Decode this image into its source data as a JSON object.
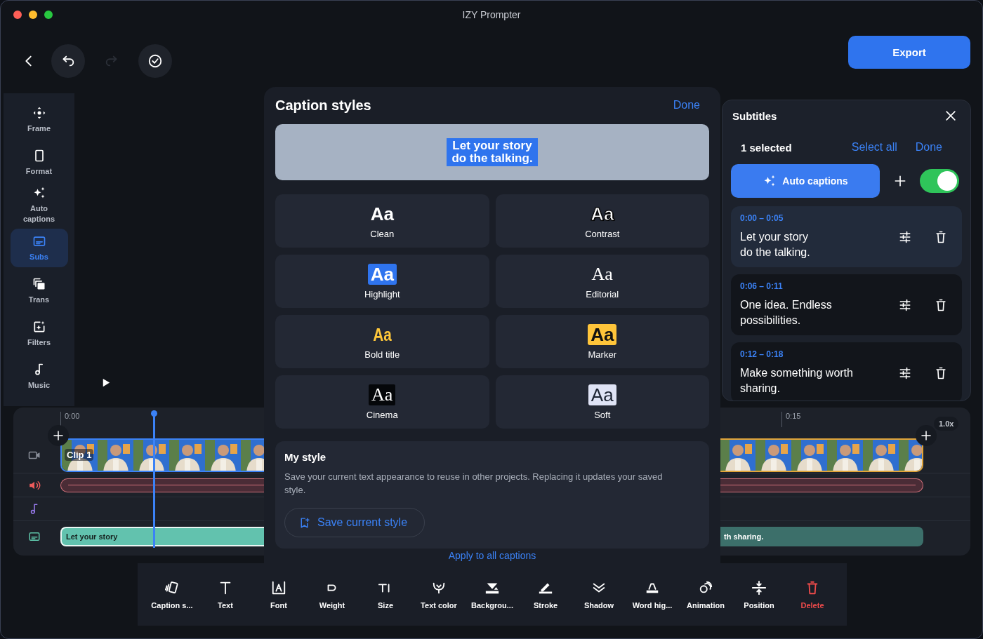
{
  "window": {
    "title": "IZY Prompter"
  },
  "nav_buttons": [
    {
      "kind": "back"
    },
    {
      "kind": "undo",
      "disabled": false
    },
    {
      "kind": "redo",
      "disabled": true
    },
    {
      "kind": "confirm"
    }
  ],
  "export_button": "Export",
  "sidebar": {
    "items": [
      {
        "label": "Frame",
        "kind": "move",
        "selected": false
      },
      {
        "label": "Format",
        "kind": "format",
        "selected": false
      },
      {
        "label": "Auto captions",
        "kind": "sparkle",
        "selected": false
      },
      {
        "label": "Subs",
        "kind": "subtitles",
        "selected": true
      },
      {
        "label": "Trans",
        "kind": "stack",
        "selected": false
      },
      {
        "label": "Filters",
        "kind": "filters",
        "selected": false
      },
      {
        "label": "Music",
        "kind": "music",
        "selected": false
      }
    ]
  },
  "timeline": {
    "ruler_labels": [
      "0:00",
      "0:15"
    ],
    "speed": "1.0x",
    "video_clips": [
      {
        "label": "Clip 1",
        "selected": true
      },
      {
        "selected": false
      }
    ],
    "caption_clips": [
      {
        "text": "Let your story",
        "selected": true
      },
      {
        "text": "th sharing.",
        "selected": false
      }
    ]
  },
  "caption_styles": {
    "title": "Caption styles",
    "done": "Done",
    "preview_lines": [
      "Let your story",
      "do the talking."
    ],
    "styles": [
      {
        "sample": "Aa",
        "label": "Clean",
        "kind": "clean"
      },
      {
        "sample": "Aa",
        "label": "Contrast",
        "kind": "contrast"
      },
      {
        "sample": "Aa",
        "label": "Highlight",
        "kind": "highlight"
      },
      {
        "sample": "Aa",
        "label": "Editorial",
        "kind": "editorial"
      },
      {
        "sample": "Aa",
        "label": "Bold title",
        "kind": "bold_title"
      },
      {
        "sample": "Aa",
        "label": "Marker",
        "kind": "marker"
      },
      {
        "sample": "Aa",
        "label": "Cinema",
        "kind": "cinema"
      },
      {
        "sample": "Aa",
        "label": "Soft",
        "kind": "soft"
      }
    ],
    "my_style": {
      "title": "My style",
      "description": "Save your current text appearance to reuse in other projects. Replacing it updates your saved style.",
      "button": "Save current style"
    },
    "apply_link": "Apply to all captions"
  },
  "subtitles": {
    "title": "Subtitles",
    "selected_count": "1 selected",
    "select_all": "Select all",
    "done": "Done",
    "auto_captions": "Auto captions",
    "toggle_on": true,
    "items": [
      {
        "time": "0:00 – 0:05",
        "text": "Let your story\ndo the talking.",
        "selected": true
      },
      {
        "time": "0:06 – 0:11",
        "text": "One idea. Endless possibilities.",
        "selected": false
      },
      {
        "time": "0:12 – 0:18",
        "text": "Make something worth sharing.",
        "selected": false
      }
    ]
  },
  "toolbar": [
    {
      "label": "Caption s...",
      "kind": "cards"
    },
    {
      "label": "Text",
      "kind": "text"
    },
    {
      "label": "Font",
      "kind": "font"
    },
    {
      "label": "Weight",
      "kind": "weight"
    },
    {
      "label": "Size",
      "kind": "size"
    },
    {
      "label": "Text color",
      "kind": "drop"
    },
    {
      "label": "Backgrou...",
      "kind": "background"
    },
    {
      "label": "Stroke",
      "kind": "stroke"
    },
    {
      "label": "Shadow",
      "kind": "shadow"
    },
    {
      "label": "Word hig...",
      "kind": "highlight"
    },
    {
      "label": "Animation",
      "kind": "animation"
    },
    {
      "label": "Position",
      "kind": "position"
    },
    {
      "label": "Delete",
      "kind": "trash"
    }
  ]
}
